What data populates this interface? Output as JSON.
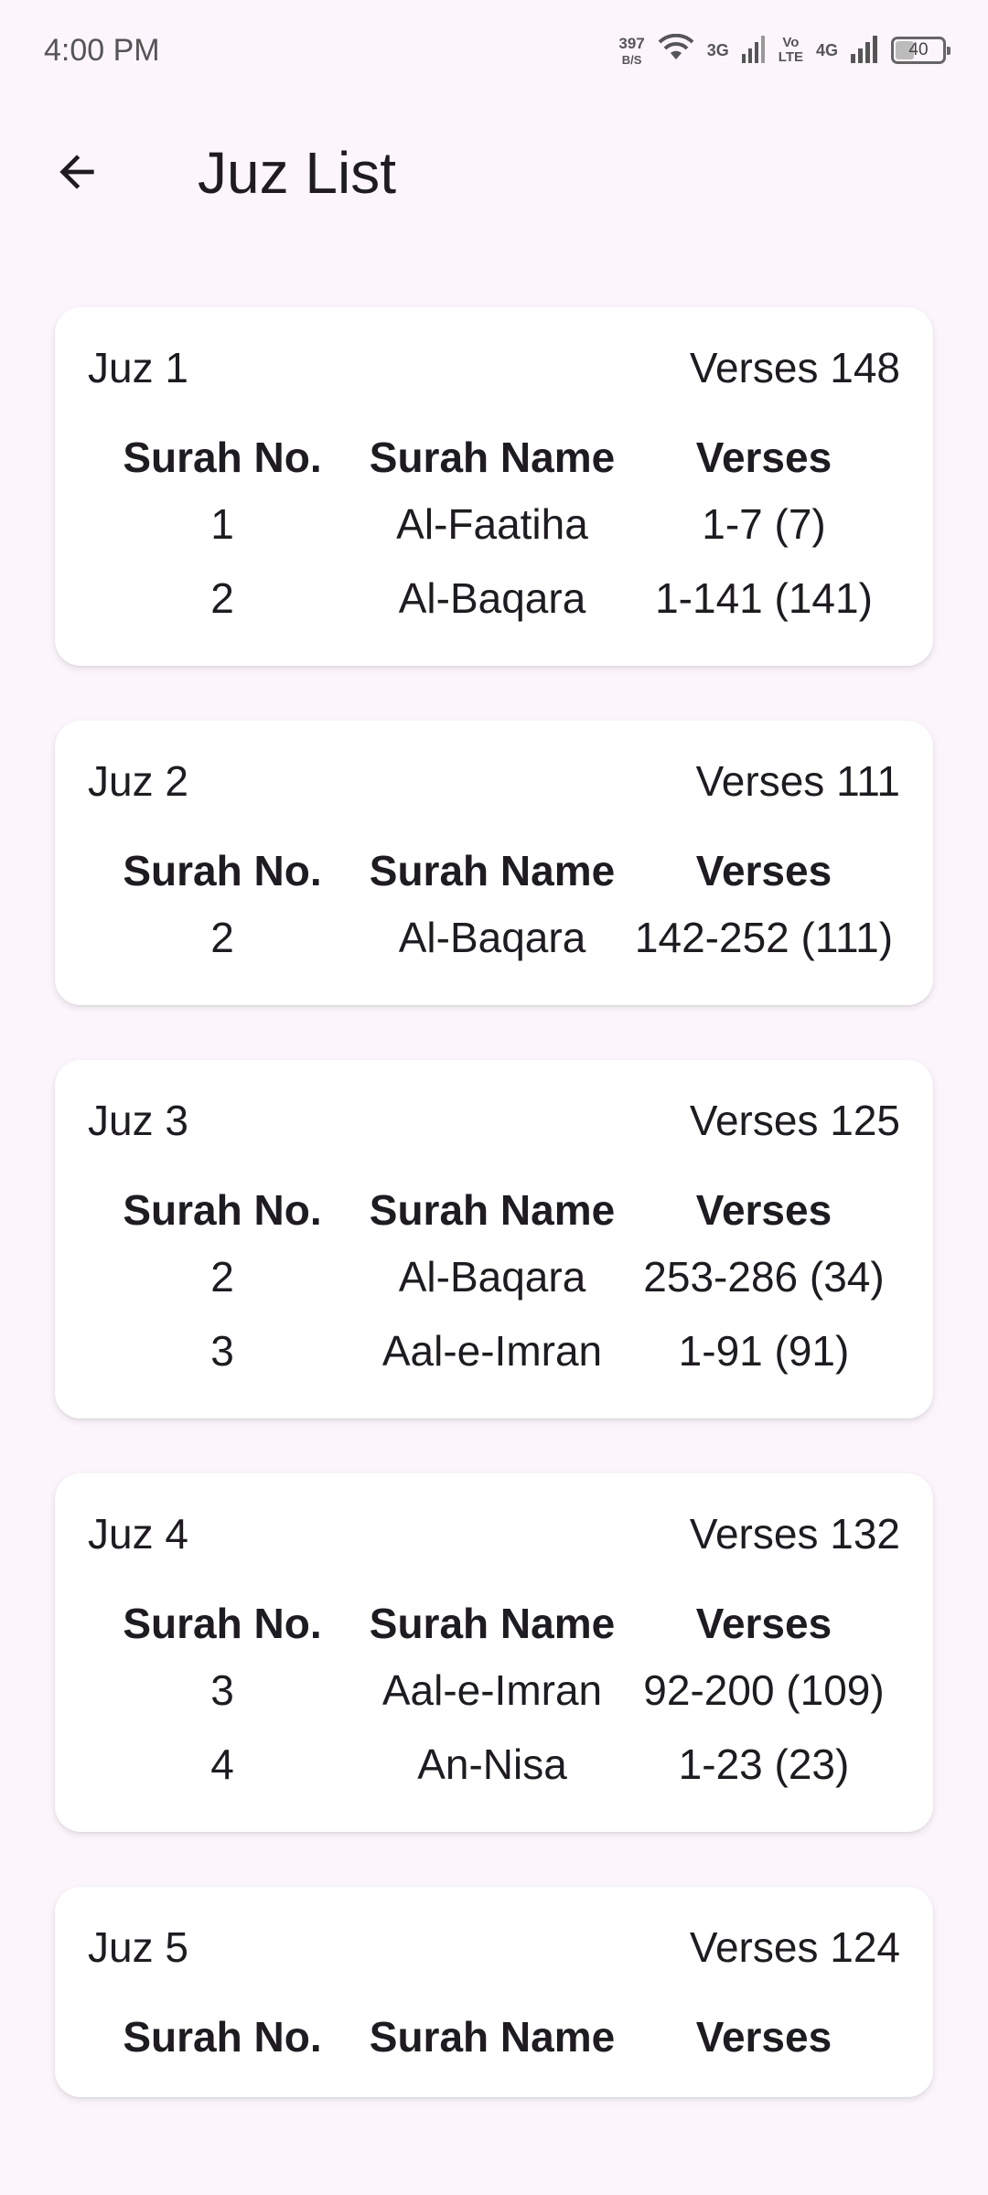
{
  "status_bar": {
    "time": "4:00 PM",
    "net_speed_value": "397",
    "net_speed_unit": "B/S",
    "network_3g": "3G",
    "volte_top": "Vo",
    "volte_bottom": "LTE",
    "network_4g": "4G",
    "battery_level": "40",
    "battery_fraction": 0.4
  },
  "app_bar": {
    "title": "Juz List",
    "back_icon": "arrow-back-icon"
  },
  "table_headers": {
    "surah_no": "Surah No.",
    "surah_name": "Surah Name",
    "verses": "Verses"
  },
  "juz": [
    {
      "name": "Juz 1",
      "verses_total": "Verses 148",
      "rows": [
        {
          "no": "1",
          "name": "Al-Faatiha",
          "verses": "1-7 (7)"
        },
        {
          "no": "2",
          "name": "Al-Baqara",
          "verses": "1-141 (141)"
        }
      ]
    },
    {
      "name": "Juz 2",
      "verses_total": "Verses 111",
      "rows": [
        {
          "no": "2",
          "name": "Al-Baqara",
          "verses": "142-252 (111)"
        }
      ]
    },
    {
      "name": "Juz 3",
      "verses_total": "Verses 125",
      "rows": [
        {
          "no": "2",
          "name": "Al-Baqara",
          "verses": "253-286 (34)"
        },
        {
          "no": "3",
          "name": "Aal-e-Imran",
          "verses": "1-91 (91)"
        }
      ]
    },
    {
      "name": "Juz 4",
      "verses_total": "Verses 132",
      "rows": [
        {
          "no": "3",
          "name": "Aal-e-Imran",
          "verses": "92-200 (109)"
        },
        {
          "no": "4",
          "name": "An-Nisa",
          "verses": "1-23 (23)"
        }
      ]
    },
    {
      "name": "Juz 5",
      "verses_total": "Verses 124",
      "rows": []
    }
  ]
}
